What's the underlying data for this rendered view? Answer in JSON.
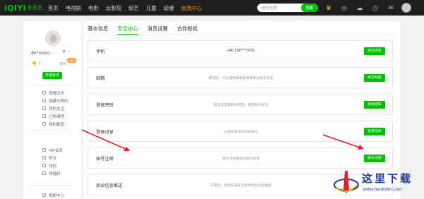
{
  "header": {
    "logo_mark": "iQIYI",
    "logo_text": "爱奇艺",
    "nav": [
      "首页",
      "电视剧",
      "电影",
      "云影院",
      "综艺",
      "儿童",
      "动漫",
      "会员中心"
    ],
    "active_nav_index": 7,
    "search_placeholder": "迷你无限",
    "search_button": "搜索",
    "colors": {
      "bar": "#1e1e1e",
      "accent": "#00be06",
      "active_nav": "#ff9e1b"
    }
  },
  "sidebar": {
    "username": "用户669b0…",
    "coins_label": "0",
    "vip_badge": "VIP",
    "vip_label": "签到",
    "open_vip": "开通会员",
    "group1": [
      "观看历史",
      "收藏与预约",
      "我的关注",
      "已购课程",
      "我的截图"
    ],
    "group2": [
      "VIP会员",
      "积分",
      "钱包",
      "领福利"
    ],
    "group3": [
      "帮助中心"
    ]
  },
  "tabs": [
    "基本信息",
    "安全中心",
    "消息设置",
    "合作授权"
  ],
  "active_tab_index": 1,
  "security_rows": [
    {
      "label": "手机",
      "desc": "+86 158****3701",
      "action": "修改手机",
      "dark": true
    },
    {
      "label": "邮箱",
      "desc": "绑定后，可以使用邮箱登录来保证账号安全",
      "action": "绑定邮箱",
      "dark": false
    },
    {
      "label": "登录密码",
      "desc": "建议您定期修改密码，保证账号安全",
      "action": "修改密码",
      "dark": false
    },
    {
      "label": "登录记录",
      "desc": "记录您账号的登录情况",
      "action": "查看记录",
      "dark": false
    },
    {
      "label": "账号注销",
      "desc": "账号注销相关的操作管理",
      "action": "账号注销",
      "dark": false
    },
    {
      "label": "商业信息推送",
      "desc": "开启后，您将在爱奇艺收到商业信息推送",
      "action": "",
      "dark": false
    }
  ],
  "watermark": {
    "title": "这里下载",
    "url": "www.herdown.com"
  }
}
